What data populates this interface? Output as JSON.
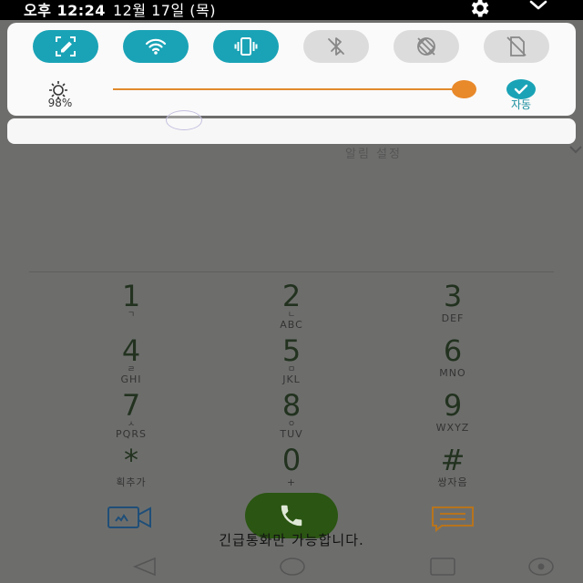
{
  "status_bar": {
    "time": "오후 12:24",
    "date": "12월 17일 (목)"
  },
  "quick_settings": {
    "toggles": [
      {
        "name": "screen-capture",
        "state": "on"
      },
      {
        "name": "wifi",
        "state": "on"
      },
      {
        "name": "vibrate",
        "state": "on"
      },
      {
        "name": "bluetooth",
        "state": "off"
      },
      {
        "name": "auto-rotate",
        "state": "off"
      },
      {
        "name": "no-sim",
        "state": "off"
      }
    ],
    "brightness_percent": "98%",
    "brightness_value": 0.98,
    "auto_label": "자동"
  },
  "background": {
    "alarm_settings": "알림 설정"
  },
  "dialpad": {
    "keys": [
      {
        "digit": "1",
        "hangul": "ㄱ",
        "letters": ""
      },
      {
        "digit": "2",
        "hangul": "ㄴ",
        "letters": "ABC"
      },
      {
        "digit": "3",
        "hangul": "",
        "letters": "DEF"
      },
      {
        "digit": "4",
        "hangul": "ㄹ",
        "letters": "GHI"
      },
      {
        "digit": "5",
        "hangul": "ㅁ",
        "letters": "JKL"
      },
      {
        "digit": "6",
        "hangul": "",
        "letters": "MNO"
      },
      {
        "digit": "7",
        "hangul": "ㅅ",
        "letters": "PQRS"
      },
      {
        "digit": "8",
        "hangul": "ㅇ",
        "letters": "TUV"
      },
      {
        "digit": "9",
        "hangul": "",
        "letters": "WXYZ"
      },
      {
        "digit": "*",
        "hangul": "",
        "letters": "획추가"
      },
      {
        "digit": "0",
        "hangul": "",
        "letters": "+"
      },
      {
        "digit": "#",
        "hangul": "",
        "letters": "쌍자음"
      }
    ]
  },
  "emergency_text": "긴급통화만 가능합니다.",
  "colors": {
    "accent_teal": "#1aa3b6",
    "slider_orange": "#e8892a",
    "call_green": "#2a5512",
    "video_blue": "#1f4e78",
    "message_orange": "#b8741c"
  }
}
